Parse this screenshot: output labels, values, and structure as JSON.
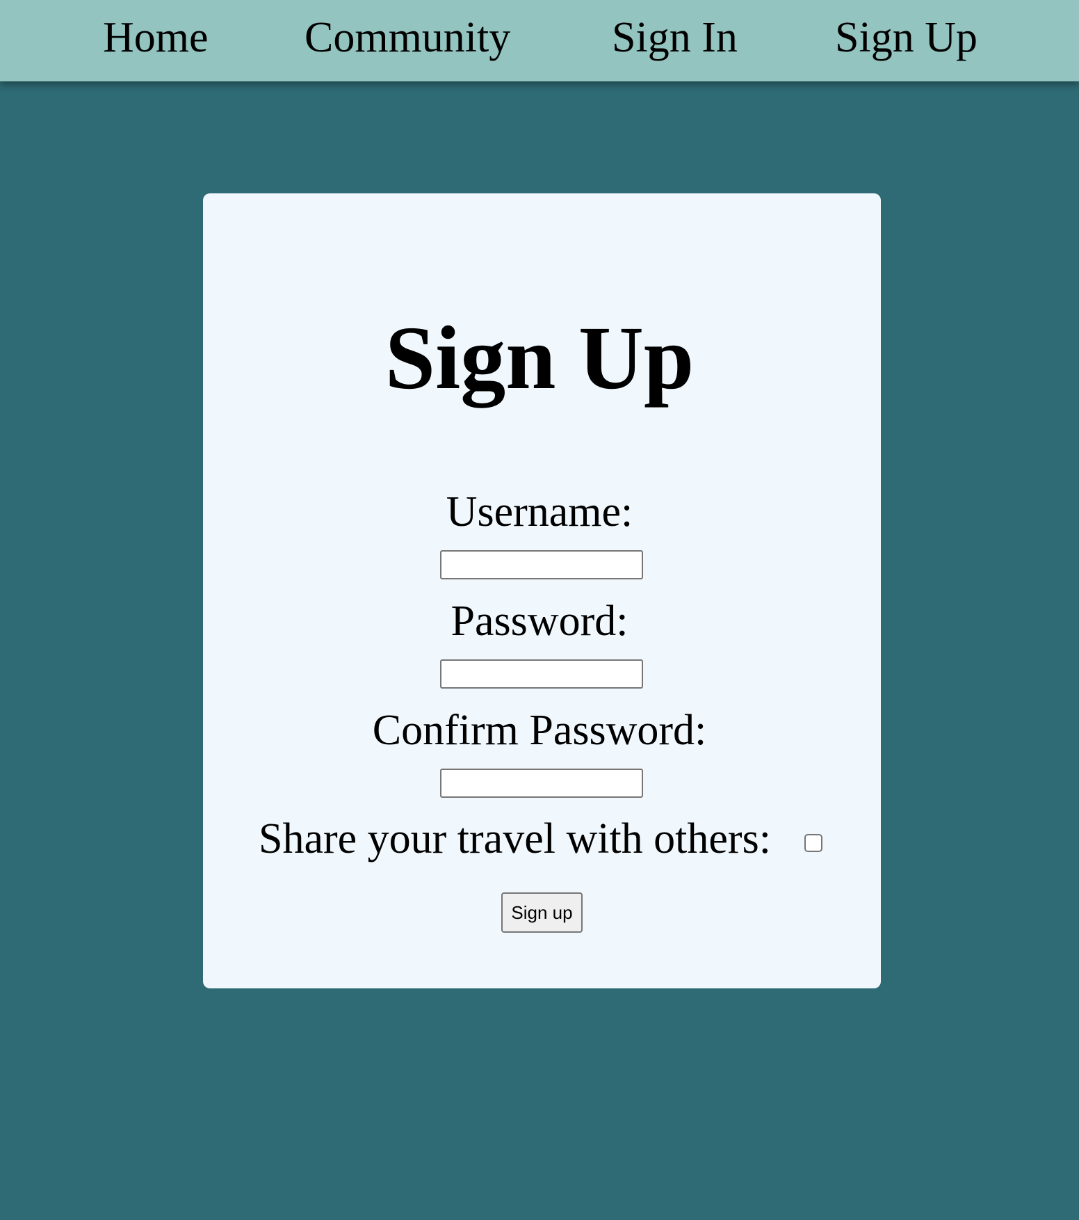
{
  "nav": {
    "home": "Home",
    "community": "Community",
    "sign_in": "Sign In",
    "sign_up": "Sign Up"
  },
  "form": {
    "title": "Sign Up",
    "username_label": "Username:",
    "username_value": "",
    "password_label": "Password:",
    "password_value": "",
    "confirm_label": "Confirm Password:",
    "confirm_value": "",
    "share_label": "Share your travel with others:",
    "share_checked": false,
    "submit_label": "Sign up"
  },
  "colors": {
    "page_background": "#2f6b74",
    "navbar_background": "#94c4bf",
    "card_background": "#f1f8fd"
  }
}
